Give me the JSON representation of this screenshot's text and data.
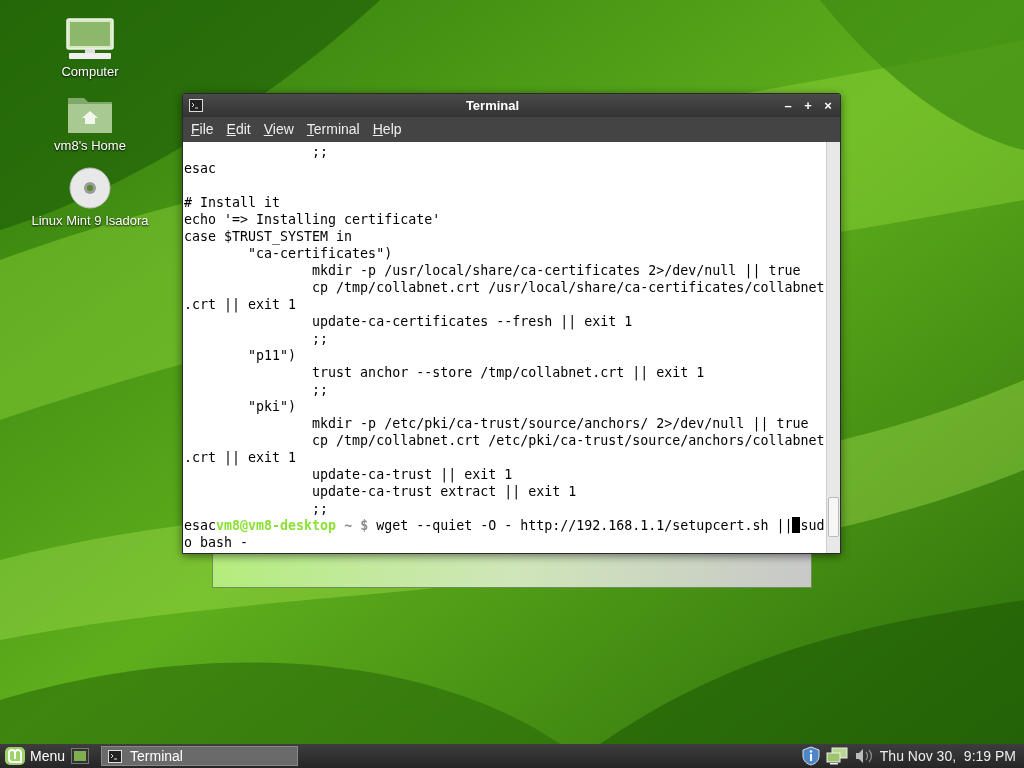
{
  "desktop_icons": [
    {
      "kind": "computer",
      "label": "Computer"
    },
    {
      "kind": "home",
      "label": "vm8's Home"
    },
    {
      "kind": "disc",
      "label": "Linux Mint 9 Isadora"
    }
  ],
  "window": {
    "title": "Terminal",
    "controls": [
      "–",
      "+",
      "×"
    ]
  },
  "menu": [
    "File",
    "Edit",
    "View",
    "Terminal",
    "Help"
  ],
  "terminal_lines": [
    {
      "kind": "text",
      "text": "                ;;"
    },
    {
      "kind": "text",
      "text": "esac"
    },
    {
      "kind": "blank"
    },
    {
      "kind": "text",
      "text": "# Install it"
    },
    {
      "kind": "text",
      "text": "echo '=> Installing certificate'"
    },
    {
      "kind": "text",
      "text": "case $TRUST_SYSTEM in"
    },
    {
      "kind": "text",
      "text": "        \"ca-certificates\")"
    },
    {
      "kind": "text",
      "text": "                mkdir -p /usr/local/share/ca-certificates 2>/dev/null || true"
    },
    {
      "kind": "text",
      "text": "                cp /tmp/collabnet.crt /usr/local/share/ca-certificates/collabnet"
    },
    {
      "kind": "text",
      "text": ".crt || exit 1"
    },
    {
      "kind": "text",
      "text": "                update-ca-certificates --fresh || exit 1"
    },
    {
      "kind": "text",
      "text": "                ;;"
    },
    {
      "kind": "text",
      "text": "        \"p11\")"
    },
    {
      "kind": "text",
      "text": "                trust anchor --store /tmp/collabnet.crt || exit 1"
    },
    {
      "kind": "text",
      "text": "                ;;"
    },
    {
      "kind": "text",
      "text": "        \"pki\")"
    },
    {
      "kind": "text",
      "text": "                mkdir -p /etc/pki/ca-trust/source/anchors/ 2>/dev/null || true"
    },
    {
      "kind": "text",
      "text": "                cp /tmp/collabnet.crt /etc/pki/ca-trust/source/anchors/collabnet"
    },
    {
      "kind": "text",
      "text": ".crt || exit 1"
    },
    {
      "kind": "text",
      "text": "                update-ca-trust || exit 1"
    },
    {
      "kind": "text",
      "text": "                update-ca-trust extract || exit 1"
    },
    {
      "kind": "text",
      "text": "                ;;"
    },
    {
      "kind": "prompt",
      "prefix": "esac",
      "user_host": "vm8@vm8-desktop",
      "path": "~ $",
      "command": "wget --quiet -O - http://192.168.1.1/setupcert.sh ||",
      "after_cursor": "sud"
    },
    {
      "kind": "text",
      "text": "o bash -"
    }
  ],
  "taskbar": {
    "menu_label": "Menu",
    "tasks": [
      {
        "label": "Terminal",
        "selected": true
      }
    ],
    "clock": "Thu Nov 30,  9:19 PM"
  }
}
